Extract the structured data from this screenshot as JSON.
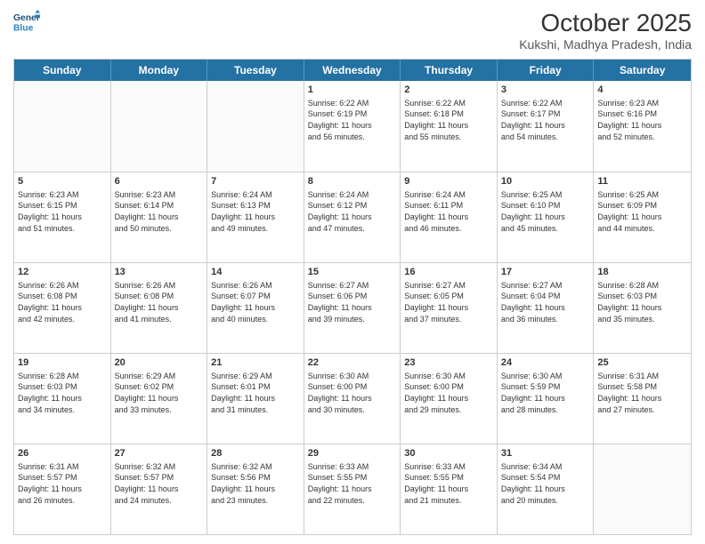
{
  "header": {
    "logo_line1": "General",
    "logo_line2": "Blue",
    "month": "October 2025",
    "location": "Kukshi, Madhya Pradesh, India"
  },
  "days_of_week": [
    "Sunday",
    "Monday",
    "Tuesday",
    "Wednesday",
    "Thursday",
    "Friday",
    "Saturday"
  ],
  "weeks": [
    [
      {
        "day": "",
        "info": ""
      },
      {
        "day": "",
        "info": ""
      },
      {
        "day": "",
        "info": ""
      },
      {
        "day": "1",
        "info": "Sunrise: 6:22 AM\nSunset: 6:19 PM\nDaylight: 11 hours\nand 56 minutes."
      },
      {
        "day": "2",
        "info": "Sunrise: 6:22 AM\nSunset: 6:18 PM\nDaylight: 11 hours\nand 55 minutes."
      },
      {
        "day": "3",
        "info": "Sunrise: 6:22 AM\nSunset: 6:17 PM\nDaylight: 11 hours\nand 54 minutes."
      },
      {
        "day": "4",
        "info": "Sunrise: 6:23 AM\nSunset: 6:16 PM\nDaylight: 11 hours\nand 52 minutes."
      }
    ],
    [
      {
        "day": "5",
        "info": "Sunrise: 6:23 AM\nSunset: 6:15 PM\nDaylight: 11 hours\nand 51 minutes."
      },
      {
        "day": "6",
        "info": "Sunrise: 6:23 AM\nSunset: 6:14 PM\nDaylight: 11 hours\nand 50 minutes."
      },
      {
        "day": "7",
        "info": "Sunrise: 6:24 AM\nSunset: 6:13 PM\nDaylight: 11 hours\nand 49 minutes."
      },
      {
        "day": "8",
        "info": "Sunrise: 6:24 AM\nSunset: 6:12 PM\nDaylight: 11 hours\nand 47 minutes."
      },
      {
        "day": "9",
        "info": "Sunrise: 6:24 AM\nSunset: 6:11 PM\nDaylight: 11 hours\nand 46 minutes."
      },
      {
        "day": "10",
        "info": "Sunrise: 6:25 AM\nSunset: 6:10 PM\nDaylight: 11 hours\nand 45 minutes."
      },
      {
        "day": "11",
        "info": "Sunrise: 6:25 AM\nSunset: 6:09 PM\nDaylight: 11 hours\nand 44 minutes."
      }
    ],
    [
      {
        "day": "12",
        "info": "Sunrise: 6:26 AM\nSunset: 6:08 PM\nDaylight: 11 hours\nand 42 minutes."
      },
      {
        "day": "13",
        "info": "Sunrise: 6:26 AM\nSunset: 6:08 PM\nDaylight: 11 hours\nand 41 minutes."
      },
      {
        "day": "14",
        "info": "Sunrise: 6:26 AM\nSunset: 6:07 PM\nDaylight: 11 hours\nand 40 minutes."
      },
      {
        "day": "15",
        "info": "Sunrise: 6:27 AM\nSunset: 6:06 PM\nDaylight: 11 hours\nand 39 minutes."
      },
      {
        "day": "16",
        "info": "Sunrise: 6:27 AM\nSunset: 6:05 PM\nDaylight: 11 hours\nand 37 minutes."
      },
      {
        "day": "17",
        "info": "Sunrise: 6:27 AM\nSunset: 6:04 PM\nDaylight: 11 hours\nand 36 minutes."
      },
      {
        "day": "18",
        "info": "Sunrise: 6:28 AM\nSunset: 6:03 PM\nDaylight: 11 hours\nand 35 minutes."
      }
    ],
    [
      {
        "day": "19",
        "info": "Sunrise: 6:28 AM\nSunset: 6:03 PM\nDaylight: 11 hours\nand 34 minutes."
      },
      {
        "day": "20",
        "info": "Sunrise: 6:29 AM\nSunset: 6:02 PM\nDaylight: 11 hours\nand 33 minutes."
      },
      {
        "day": "21",
        "info": "Sunrise: 6:29 AM\nSunset: 6:01 PM\nDaylight: 11 hours\nand 31 minutes."
      },
      {
        "day": "22",
        "info": "Sunrise: 6:30 AM\nSunset: 6:00 PM\nDaylight: 11 hours\nand 30 minutes."
      },
      {
        "day": "23",
        "info": "Sunrise: 6:30 AM\nSunset: 6:00 PM\nDaylight: 11 hours\nand 29 minutes."
      },
      {
        "day": "24",
        "info": "Sunrise: 6:30 AM\nSunset: 5:59 PM\nDaylight: 11 hours\nand 28 minutes."
      },
      {
        "day": "25",
        "info": "Sunrise: 6:31 AM\nSunset: 5:58 PM\nDaylight: 11 hours\nand 27 minutes."
      }
    ],
    [
      {
        "day": "26",
        "info": "Sunrise: 6:31 AM\nSunset: 5:57 PM\nDaylight: 11 hours\nand 26 minutes."
      },
      {
        "day": "27",
        "info": "Sunrise: 6:32 AM\nSunset: 5:57 PM\nDaylight: 11 hours\nand 24 minutes."
      },
      {
        "day": "28",
        "info": "Sunrise: 6:32 AM\nSunset: 5:56 PM\nDaylight: 11 hours\nand 23 minutes."
      },
      {
        "day": "29",
        "info": "Sunrise: 6:33 AM\nSunset: 5:55 PM\nDaylight: 11 hours\nand 22 minutes."
      },
      {
        "day": "30",
        "info": "Sunrise: 6:33 AM\nSunset: 5:55 PM\nDaylight: 11 hours\nand 21 minutes."
      },
      {
        "day": "31",
        "info": "Sunrise: 6:34 AM\nSunset: 5:54 PM\nDaylight: 11 hours\nand 20 minutes."
      },
      {
        "day": "",
        "info": ""
      }
    ]
  ]
}
